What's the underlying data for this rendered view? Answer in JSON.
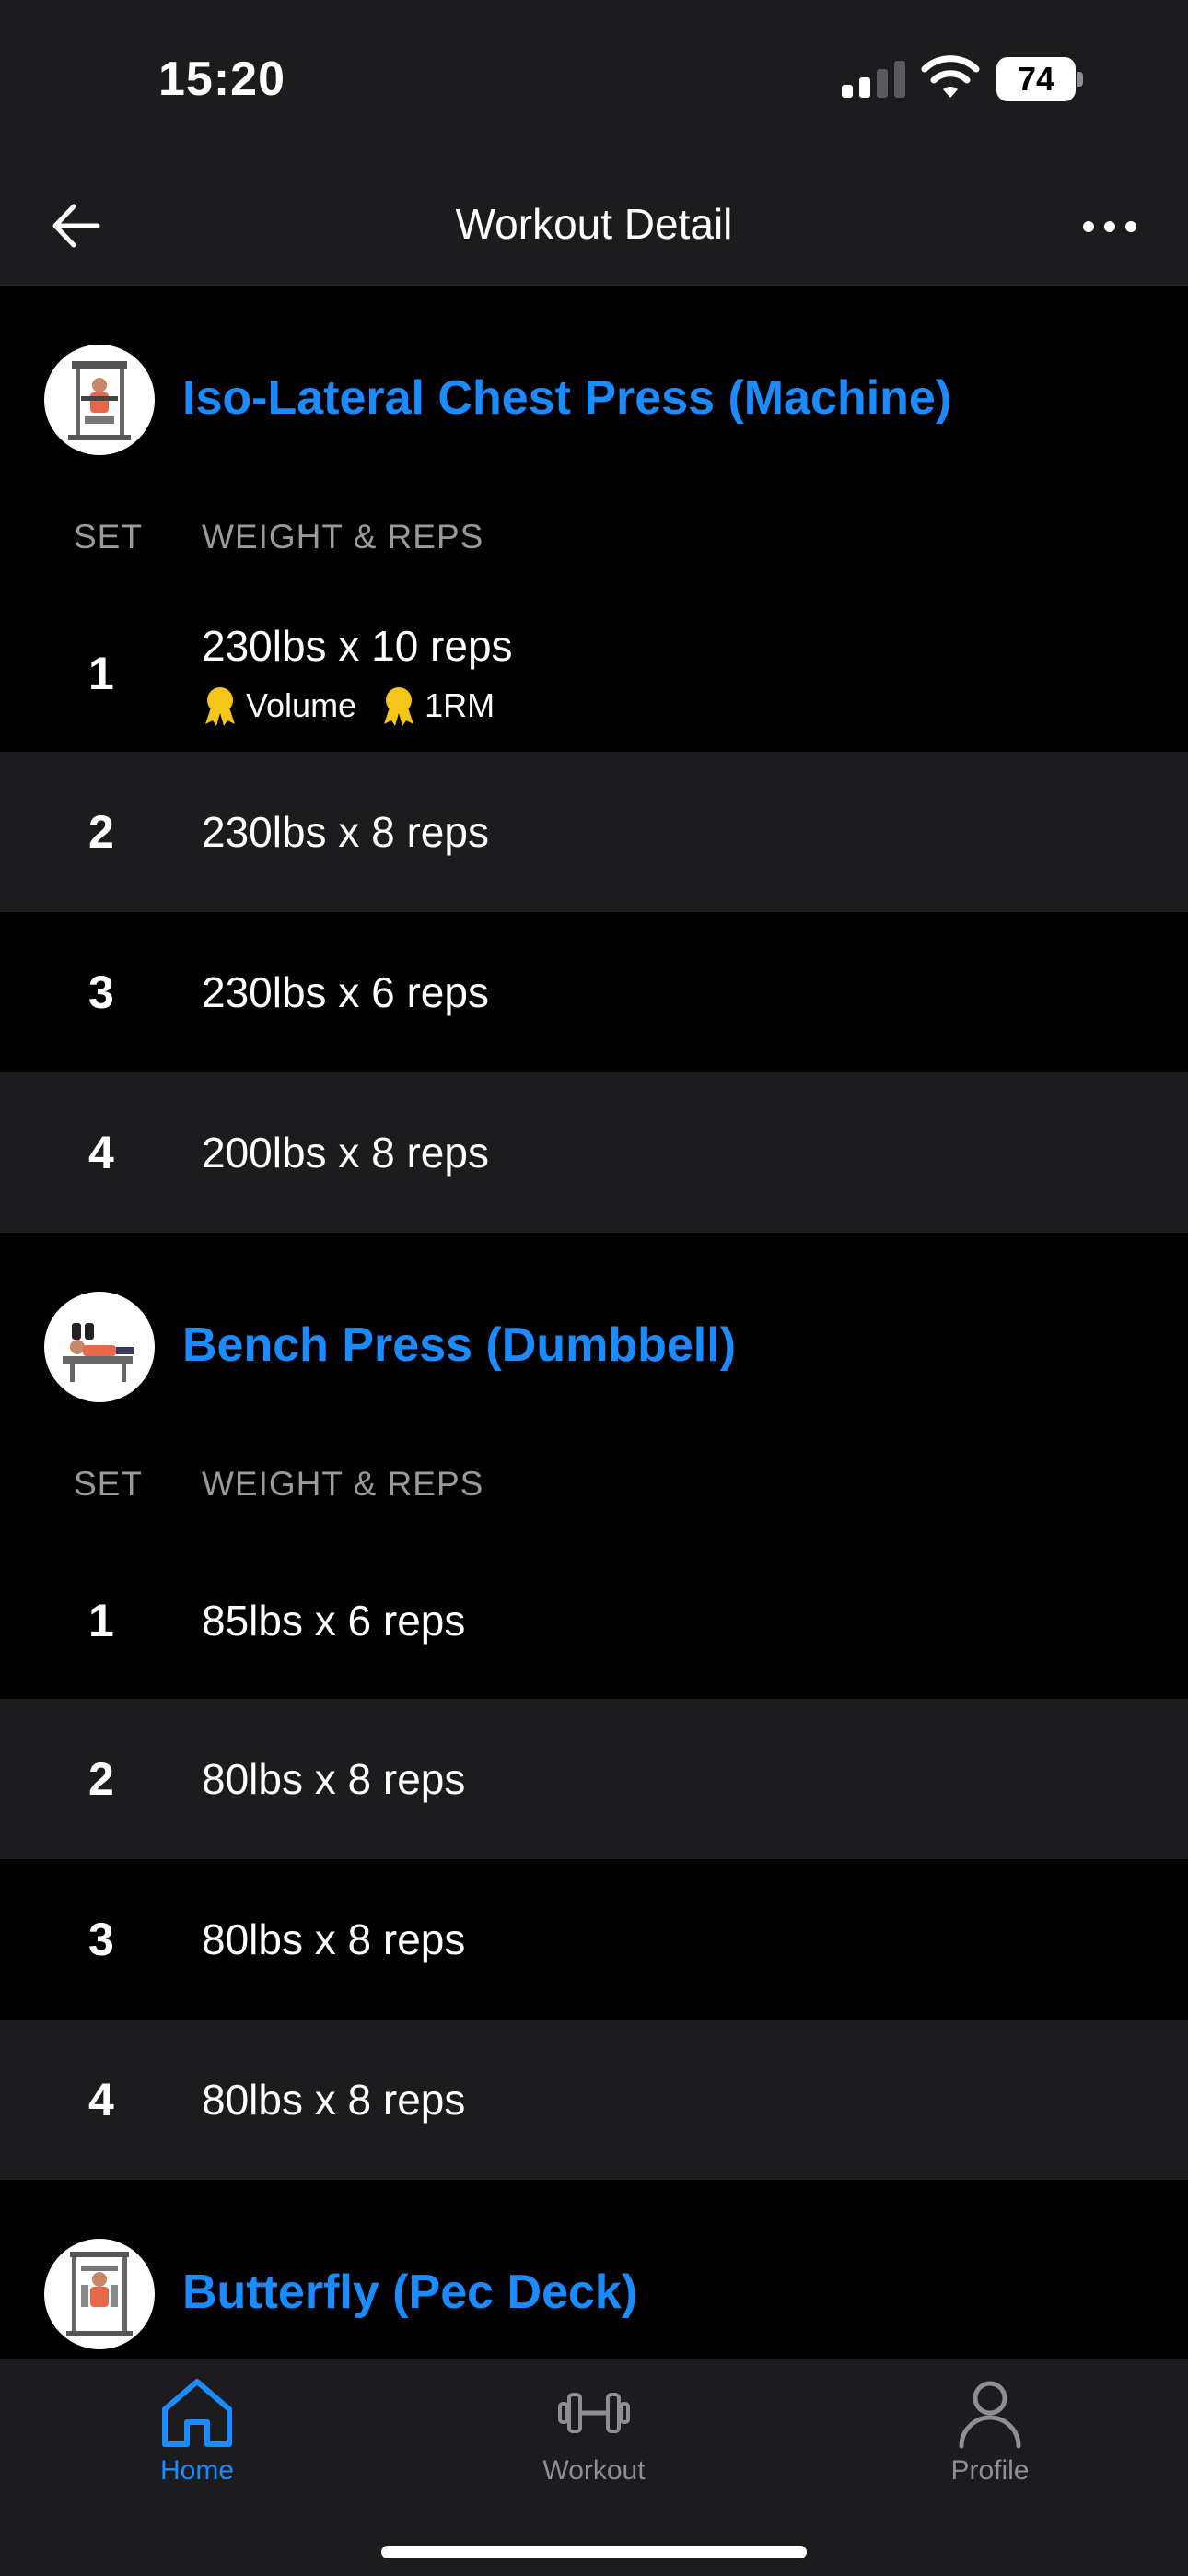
{
  "status_bar": {
    "time": "15:20",
    "battery": "74"
  },
  "nav": {
    "title": "Workout Detail",
    "back_icon": "arrow-left-icon",
    "more_icon": "ellipsis-icon"
  },
  "column_headers": {
    "set": "SET",
    "weight_reps": "WEIGHT & REPS"
  },
  "exercises": [
    {
      "title": "Iso-Lateral Chest Press (Machine)",
      "sets": [
        {
          "num": "1",
          "value": "230lbs x 10 reps",
          "badges": [
            "Volume",
            "1RM"
          ]
        },
        {
          "num": "2",
          "value": "230lbs x 8 reps"
        },
        {
          "num": "3",
          "value": "230lbs x 6 reps"
        },
        {
          "num": "4",
          "value": "200lbs x 8 reps"
        }
      ]
    },
    {
      "title": "Bench Press (Dumbbell)",
      "sets": [
        {
          "num": "1",
          "value": "85lbs x 6 reps"
        },
        {
          "num": "2",
          "value": "80lbs x 8 reps"
        },
        {
          "num": "3",
          "value": "80lbs x 8 reps"
        },
        {
          "num": "4",
          "value": "80lbs x 8 reps"
        }
      ]
    },
    {
      "title": "Butterfly (Pec Deck)",
      "sets": []
    }
  ],
  "tabs": [
    {
      "label": "Home",
      "icon": "home-icon",
      "active": true
    },
    {
      "label": "Workout",
      "icon": "dumbbell-icon",
      "active": false
    },
    {
      "label": "Profile",
      "icon": "person-icon",
      "active": false
    }
  ],
  "colors": {
    "accent": "#1a8cff",
    "background": "#000000",
    "surface": "#1c1c1e",
    "muted_text": "#9a9a9e",
    "medal": "#f5c518"
  }
}
